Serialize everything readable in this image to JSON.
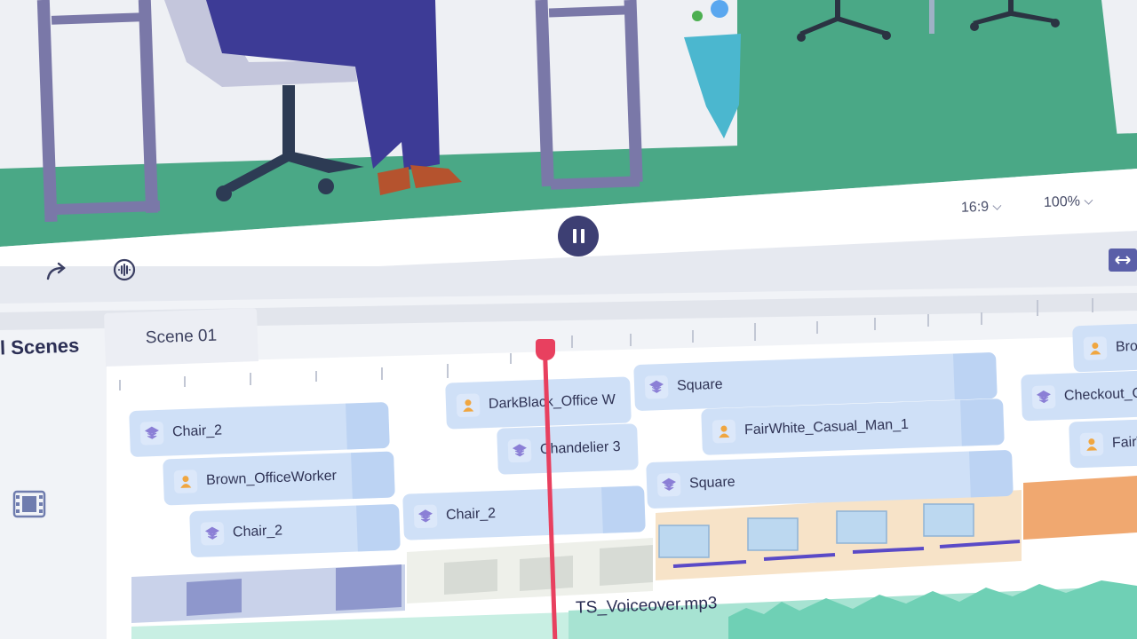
{
  "toolbar": {
    "aspect_ratio": "16:9",
    "zoom": "100%",
    "pause_icon": "pause-icon",
    "redo_icon": "redo-icon",
    "voice_icon": "voice-wave-icon",
    "fit_icon": "fit-width-icon"
  },
  "sidebar": {
    "title": "l Scenes",
    "film_icon": "film-strip-icon"
  },
  "scene_tab": {
    "label": "Scene 01"
  },
  "tracks": {
    "clips": [
      {
        "label": "Chair_2",
        "icon": "prop-icon"
      },
      {
        "label": "Brown_OfficeWorker",
        "icon": "character-icon"
      },
      {
        "label": "Chair_2",
        "icon": "prop-icon"
      },
      {
        "label": "DarkBlack_Office W",
        "icon": "character-icon"
      },
      {
        "label": "Chandelier 3",
        "icon": "prop-icon"
      },
      {
        "label": "Chair_2",
        "icon": "prop-icon"
      },
      {
        "label": "Square",
        "icon": "prop-icon"
      },
      {
        "label": "FairWhite_Casual_Man_1",
        "icon": "character-icon"
      },
      {
        "label": "Square",
        "icon": "prop-icon"
      },
      {
        "label": "Brown",
        "icon": "character-icon"
      },
      {
        "label": "Checkout_Cou",
        "icon": "prop-icon"
      },
      {
        "label": "FairWh",
        "icon": "character-icon"
      }
    ],
    "audio_label": "TS_Voiceover.mp3"
  },
  "colors": {
    "accent": "#3d3f73",
    "playhead": "#e8405f",
    "clip": "#cfe0f7",
    "floor": "#4aa886"
  }
}
